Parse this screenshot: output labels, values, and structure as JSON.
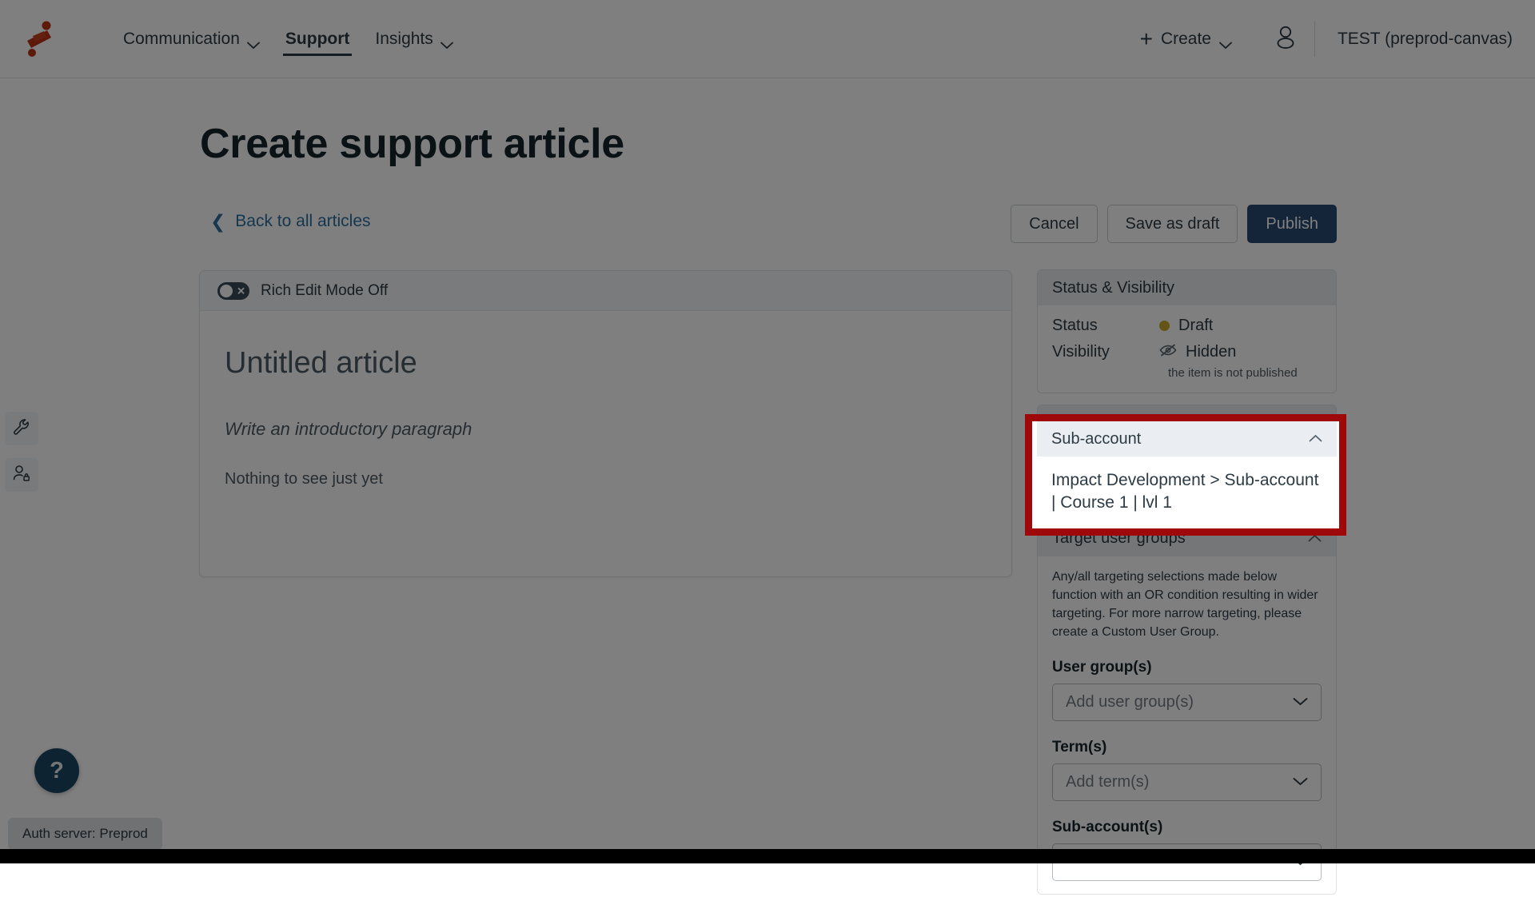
{
  "topnav": {
    "logo_icon": "brand-logo-icon",
    "items": [
      {
        "label": "Communication",
        "has_chevron": true,
        "active": false
      },
      {
        "label": "Support",
        "has_chevron": false,
        "active": true
      },
      {
        "label": "Insights",
        "has_chevron": true,
        "active": false
      }
    ],
    "create_label": "Create",
    "create_icon": "plus-icon",
    "account_icon": "user-icon",
    "env_label": "TEST (preprod-canvas)"
  },
  "rail": {
    "items": [
      {
        "icon": "wrench-icon",
        "name": "tools"
      },
      {
        "icon": "user-lock-icon",
        "name": "impersonate"
      }
    ]
  },
  "header": {
    "title": "Create support article",
    "back_label": "Back to all articles",
    "back_icon": "chevron-left-icon"
  },
  "actions": {
    "cancel_label": "Cancel",
    "save_draft_label": "Save as draft",
    "publish_label": "Publish",
    "publish_color": "#2b4b72"
  },
  "editor": {
    "toolbar": {
      "toggle_label": "Rich Edit Mode Off",
      "toggle_state": "off",
      "toggle_icon": "toggle-off-icon"
    },
    "title": "Untitled article",
    "intro_placeholder": "Write an introductory paragraph",
    "body_note": "Nothing to see just yet"
  },
  "sidebar": {
    "status_panel": {
      "title": "Status & Visibility",
      "rows": [
        {
          "key": "Status",
          "value": "Draft",
          "icon": "status-dot-icon",
          "dot_color": "#c8ab2c",
          "sub": ""
        },
        {
          "key": "Visibility",
          "value": "Hidden",
          "icon": "eye-slash-icon",
          "sub": "the item is not published"
        }
      ]
    },
    "subaccount_panel": {
      "title": "Sub-account",
      "collapse_icon": "chevron-up-icon",
      "value": "Impact Development > Sub-account | Course 1 | lvl 1",
      "highlight_color": "#9e0808"
    },
    "target_panel": {
      "title": "Target user groups",
      "collapse_icon": "chevron-up-icon",
      "description": "Any/all targeting selections made below function with an OR condition resulting in wider targeting. For more narrow targeting, please create a Custom User Group.",
      "fields": [
        {
          "label": "User group(s)",
          "placeholder": "Add user group(s)",
          "icon": "chevron-down-icon"
        },
        {
          "label": "Term(s)",
          "placeholder": "Add term(s)",
          "icon": "chevron-down-icon"
        },
        {
          "label": "Sub-account(s)",
          "placeholder": "",
          "icon": "chevron-down-icon"
        }
      ]
    }
  },
  "footer": {
    "help_label": "?",
    "help_icon": "question-mark-icon",
    "auth_label": "Auth server: Preprod"
  }
}
